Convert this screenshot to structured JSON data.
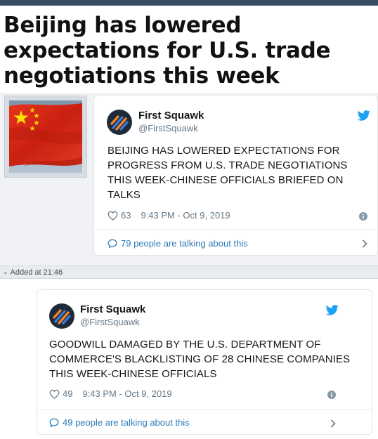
{
  "headline": "Beijing has lowered expectations for U.S. trade negotiations this week",
  "tweets": [
    {
      "author": "First Squawk",
      "handle": "@FirstSquawk",
      "text": "BEIJING HAS LOWERED EXPECTATIONS FOR PROGRESS FROM U.S. TRADE NEGOTIATIONS THIS WEEK-CHINESE OFFICIALS BRIEFED ON TALKS",
      "likes": "63",
      "timestamp": "9:43 PM - Oct 9, 2019",
      "talking": "79 people are talking about this"
    },
    {
      "author": "First Squawk",
      "handle": "@FirstSquawk",
      "text": "GOODWILL DAMAGED BY THE U.S. DEPARTMENT OF COMMERCE'S BLACKLISTING OF 28 CHINESE COMPANIES THIS WEEK-CHINESE OFFICIALS",
      "likes": "49",
      "timestamp": "9:43 PM - Oct 9, 2019",
      "talking": "49 people are talking about this"
    }
  ],
  "added_label": "Added at 21:46",
  "icons": {
    "thumbnail": "china-flag-image",
    "avatar": "first-squawk-avatar",
    "platform": "twitter-bird-icon",
    "like": "heart-icon",
    "info": "info-icon",
    "conversation": "speech-bubble-icon",
    "more": "chevron-right-icon",
    "collapse": "caret-down-icon"
  },
  "colors": {
    "twitter_blue": "#1da1f2",
    "link": "#2b7bb9",
    "flag_red": "#de2910",
    "flag_yellow": "#ffde00",
    "strip": "#e8ebef"
  }
}
